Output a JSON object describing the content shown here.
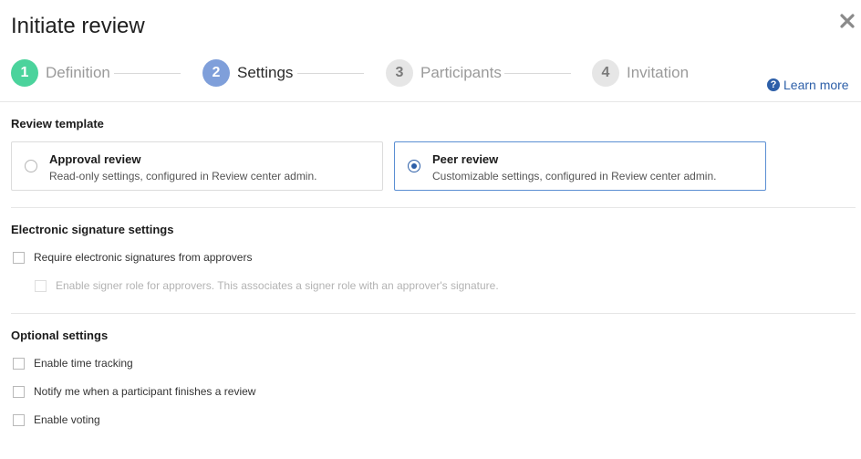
{
  "dialog": {
    "title": "Initiate review"
  },
  "steps": [
    {
      "number": "1",
      "label": "Definition"
    },
    {
      "number": "2",
      "label": "Settings"
    },
    {
      "number": "3",
      "label": "Participants"
    },
    {
      "number": "4",
      "label": "Invitation"
    }
  ],
  "help": {
    "label": "Learn more"
  },
  "review_template": {
    "heading": "Review template",
    "options": [
      {
        "title": "Approval review",
        "description": "Read-only settings, configured in Review center admin.",
        "selected": false
      },
      {
        "title": "Peer review",
        "description": "Customizable settings, configured in Review center admin.",
        "selected": true
      }
    ]
  },
  "esignature": {
    "heading": "Electronic signature settings",
    "require_label": "Require electronic signatures from approvers",
    "signer_role_label": "Enable signer role for approvers. This associates a signer role with an approver's signature."
  },
  "optional": {
    "heading": "Optional settings",
    "items": [
      {
        "label": "Enable time tracking"
      },
      {
        "label": "Notify me when a participant finishes a review"
      },
      {
        "label": "Enable voting"
      }
    ]
  },
  "colors": {
    "accent": "#2d5fa8",
    "done": "#4bd39c",
    "active": "#7f9fda",
    "selected_border": "#5b8fd3"
  }
}
